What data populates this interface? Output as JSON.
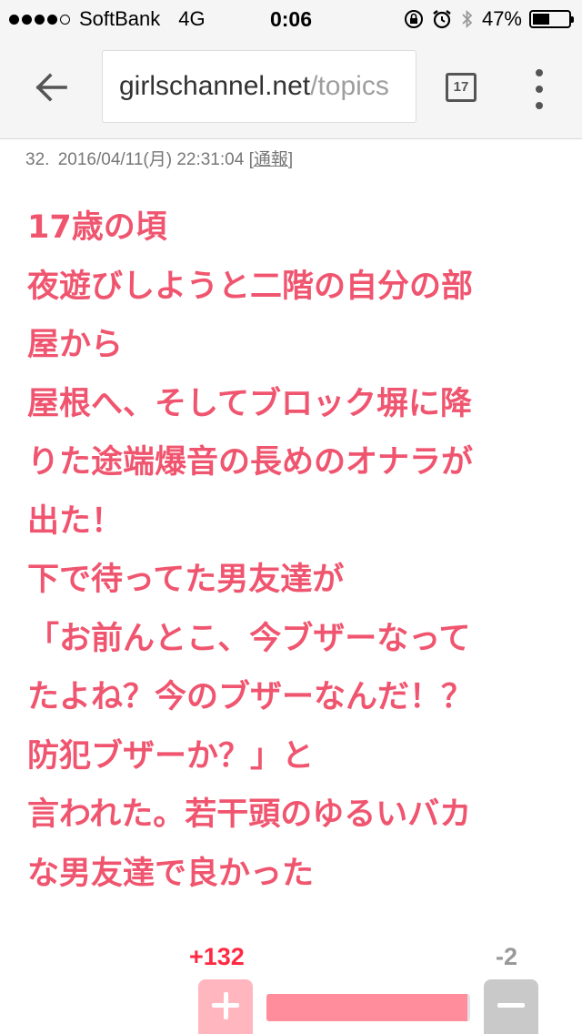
{
  "status_bar": {
    "carrier": "SoftBank",
    "network": "4G",
    "time": "0:06",
    "battery": "47%",
    "battery_fraction": 0.47,
    "signal_bars_filled": 4,
    "signal_bars_total": 5
  },
  "browser": {
    "url_host": "girlschannel.net",
    "url_path": "/topics",
    "tab_count": "17",
    "icons": {
      "back": "back-arrow-icon",
      "tabs": "tab-switcher-icon",
      "menu": "overflow-menu-icon"
    }
  },
  "post": {
    "number": "32.",
    "datetime": "2016/04/11(月) 22:31:04",
    "report_label": "通報",
    "lines": [
      "17歳の頃",
      "夜遊びしようと二階の自分の部",
      "屋から",
      "屋根へ、そしてブロック塀に降",
      "りた途端爆音の長めのオナラが",
      "出た！",
      "下で待ってた男友達が",
      "「お前んとこ、今ブザーなって",
      "たよね？今のブザーなんだ！？",
      "防犯ブザーか？」と",
      "言われた。若干頭のゆるいバカ",
      "な男友達で良かった"
    ]
  },
  "votes": {
    "plus_count": "+132",
    "minus_count": "-2",
    "plus_fraction": 0.985
  },
  "colors": {
    "post_text": "#f0556f",
    "plus_count": "#ff2a42",
    "plus_button": "#ffb6bf",
    "minus_button": "#c9c9c9",
    "bar_fill": "#ff8d9c"
  }
}
